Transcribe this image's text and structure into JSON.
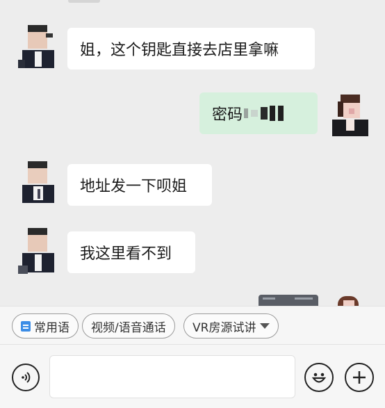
{
  "messages": [
    {
      "direction": "incoming",
      "text": "姐，这个钥匙直接去店里拿嘛"
    },
    {
      "direction": "outgoing",
      "text": "密码"
    },
    {
      "direction": "incoming",
      "text": "地址发一下呗姐"
    },
    {
      "direction": "incoming",
      "text": "我这里看不到"
    }
  ],
  "quick_replies": {
    "common_phrases": "常用语",
    "video_call": "视频/语音通话",
    "vr_tour": "VR房源试讲"
  },
  "input": {
    "placeholder": "",
    "voice_icon": "voice-icon",
    "emoji_icon": "emoji-icon",
    "plus_icon": "plus-icon"
  },
  "colors": {
    "background": "#ededed",
    "incoming_bubble": "#ffffff",
    "outgoing_bubble": "#d6f0dd",
    "chip_icon": "#3c8de6"
  }
}
